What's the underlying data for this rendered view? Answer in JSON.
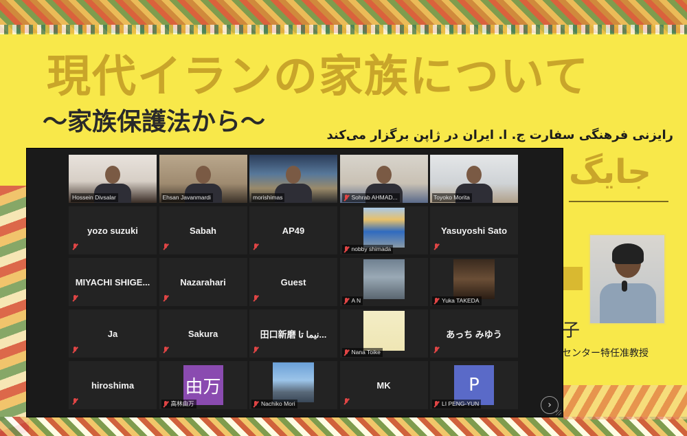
{
  "poster": {
    "title": "現代イランの家族について",
    "subtitle": "～家族保護法から～",
    "persian_line": "رایزنی فرهنگی سفارت ج. ا. ایران در ژاپن برگزار می‌کند",
    "persian_big": "جایگ",
    "speaker_char": "子",
    "speaker_role": "センター特任准教授"
  },
  "participants": [
    {
      "id": "hossein",
      "name": "Hossein Divsalar",
      "display": "video",
      "muted": false,
      "active": false
    },
    {
      "id": "ehsan",
      "name": "Ehsan Javanmardi",
      "display": "video",
      "muted": false,
      "active": false
    },
    {
      "id": "morishima",
      "name": "morishimas",
      "display": "video",
      "muted": false,
      "active": false
    },
    {
      "id": "sohrab",
      "name": "Sohrab AHMAD...",
      "display": "video",
      "muted": true,
      "active": false
    },
    {
      "id": "toyoko",
      "name": "Toyoko Morita",
      "display": "video",
      "muted": false,
      "active": true
    },
    {
      "id": "yozo",
      "name": "yozo suzuki",
      "display": "name",
      "muted": true
    },
    {
      "id": "sabah",
      "name": "Sabah",
      "display": "name",
      "muted": true
    },
    {
      "id": "ap49",
      "name": "AP49",
      "display": "name",
      "muted": true
    },
    {
      "id": "nobby",
      "name": "nobby shimada",
      "display": "photo",
      "muted": true
    },
    {
      "id": "yasuyoshi",
      "name": "Yasuyoshi Sato",
      "display": "name",
      "muted": true
    },
    {
      "id": "miyachi",
      "name": "MIYACHI SHIGE...",
      "display": "name",
      "muted": true
    },
    {
      "id": "nazarahari",
      "name": "Nazarahari",
      "display": "name",
      "muted": true
    },
    {
      "id": "guest",
      "name": "Guest",
      "display": "name",
      "muted": true
    },
    {
      "id": "an",
      "name": "A N",
      "display": "photo",
      "muted": true
    },
    {
      "id": "yuka",
      "name": "Yuka TAKEDA",
      "display": "photo",
      "muted": true
    },
    {
      "id": "ja",
      "name": "Ja",
      "display": "name",
      "muted": true
    },
    {
      "id": "sakura",
      "name": "Sakura",
      "display": "name",
      "muted": true
    },
    {
      "id": "taguchi",
      "name": "田口新磨 نیما تا...",
      "display": "name",
      "muted": true
    },
    {
      "id": "nana",
      "name": "Nana Toike",
      "display": "photo",
      "muted": true
    },
    {
      "id": "atsuchi",
      "name": "あっち みゆう",
      "display": "name",
      "muted": true
    },
    {
      "id": "hiroshima",
      "name": "hiroshima",
      "display": "name",
      "muted": true
    },
    {
      "id": "takabayashi",
      "name": "高林由万",
      "display": "letter",
      "letter": "由万",
      "letter_color": "#8a4bb0",
      "muted": true
    },
    {
      "id": "nachiko",
      "name": "Nachiko Mori",
      "display": "photo",
      "muted": true
    },
    {
      "id": "mk",
      "name": "MK",
      "display": "name",
      "muted": true
    },
    {
      "id": "li",
      "name": "LI PENG-YUN",
      "display": "letter",
      "letter": "P",
      "letter_color": "#5a6ac8",
      "muted": true
    }
  ],
  "controls": {
    "next_page_icon": "chevron-right-icon",
    "next_label": "›"
  },
  "colors": {
    "poster_bg": "#f8e84a",
    "title_gold": "#c9a52a",
    "active_speaker": "#b6d94a",
    "muted_red": "#e04545"
  }
}
